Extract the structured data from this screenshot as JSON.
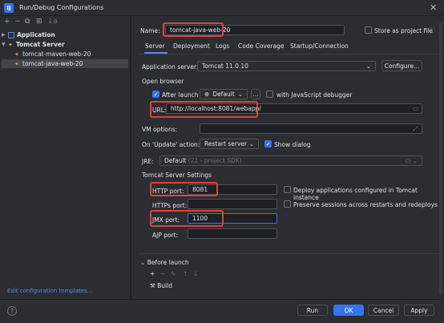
{
  "window": {
    "title": "Run/Debug Configurations",
    "app_icon": "IJ"
  },
  "left_toolbar": [
    "+",
    "−",
    "⧉",
    "⊞",
    "↓a"
  ],
  "tree": [
    {
      "label": "Application",
      "level": 0,
      "type": "group-app"
    },
    {
      "label": "Tomcat Server",
      "level": 0,
      "type": "group-tomcat"
    },
    {
      "label": "tomcat-maven-web-20",
      "level": 1,
      "type": "item"
    },
    {
      "label": "tomcat-java-web-20",
      "level": 1,
      "type": "item-selected"
    }
  ],
  "edit_templates": "Edit configuration templates...",
  "form": {
    "name_label": "Name:",
    "name_value": "tomcat-java-web-20",
    "store_label": "Store as project file",
    "tabs": [
      "Server",
      "Deployment",
      "Logs",
      "Code Coverage",
      "Startup/Connection"
    ],
    "app_server_label": "Application server:",
    "app_server_value": "Tomcat 11.0.10",
    "configure_label": "Configure...",
    "open_browser_label": "Open browser",
    "after_launch_label": "After launch",
    "browser_value": "Default",
    "ellipsis": "...",
    "js_debugger_label": "with JavaScript debugger",
    "url_label": "URL:",
    "url_value": "http://localhost:8081/webapp/",
    "vm_options_label": "VM options:",
    "on_update_label": "On 'Update' action:",
    "on_update_value": "Restart server",
    "show_dialog_label": "Show dialog",
    "jre_label": "JRE:",
    "jre_value": "Default",
    "jre_hint": "(21 - project SDK)",
    "tomcat_settings_label": "Tomcat Server Settings",
    "http_port_label": "HTTP port:",
    "http_port_value": "8081",
    "https_port_label": "HTTPs port:",
    "jmx_port_label": "JMX port:",
    "jmx_port_value": "1100",
    "ajp_port_label": "AJP port:",
    "deploy_label": "Deploy applications configured in Tomcat instance",
    "preserve_label": "Preserve sessions across restarts and redeploys",
    "before_launch_label": "Before launch",
    "before_launch_tools": [
      "+",
      "−",
      "✎",
      "↑",
      "↓"
    ],
    "build_label": "Build"
  },
  "buttons": {
    "run": "Run",
    "ok": "OK",
    "cancel": "Cancel",
    "apply": "Apply"
  },
  "colors": {
    "accent": "#3574f0",
    "highlight": "#e04040",
    "bg": "#2b2d30"
  }
}
